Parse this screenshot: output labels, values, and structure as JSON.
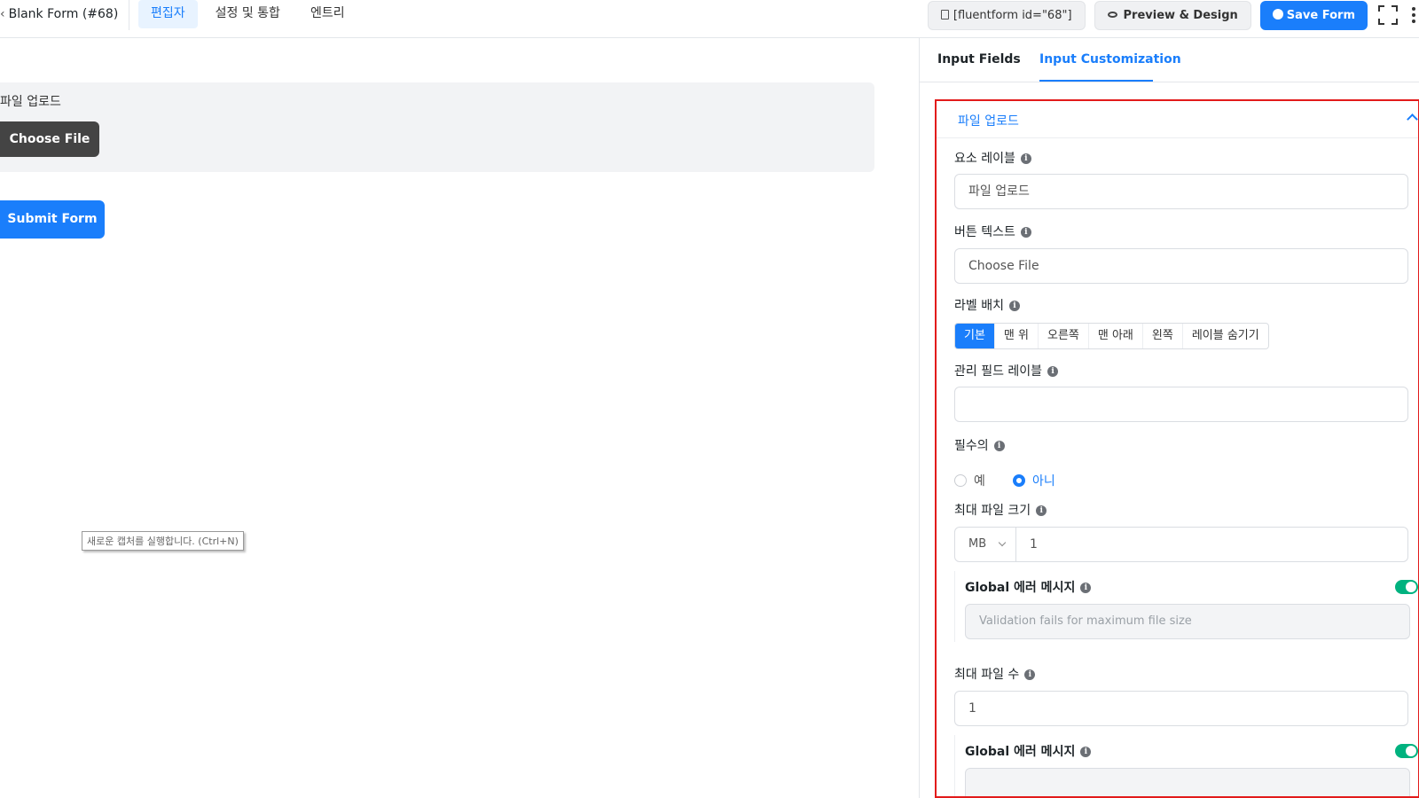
{
  "header": {
    "form_title": "Blank Form (#68)",
    "title_chevron": "‹",
    "nav_tabs": [
      {
        "label": "편집자",
        "active": true
      },
      {
        "label": "설정 및 통합",
        "active": false
      },
      {
        "label": "엔트리",
        "active": false
      }
    ],
    "shortcode_label": "[fluentform id=\"68\"]",
    "preview_label": "Preview & Design",
    "save_label": "Save Form"
  },
  "canvas": {
    "field_label": "파일 업로드",
    "choose_file_label": "Choose File",
    "submit_label": "Submit Form",
    "tooltip": "새로운 캡처를 실행합니다. (Ctrl+N)"
  },
  "panel": {
    "tabs": [
      "Input Fields",
      "Input Customization"
    ],
    "section_title": "파일 업로드",
    "element_label": {
      "label": "요소 레이블",
      "value": "파일 업로드"
    },
    "button_text": {
      "label": "버튼 텍스트",
      "value": "Choose File"
    },
    "label_placement": {
      "label": "라벨 배치",
      "options": [
        "기본",
        "맨 위",
        "오른쪽",
        "맨 아래",
        "왼쪽",
        "레이블 숨기기"
      ],
      "selected": "기본"
    },
    "admin_label": {
      "label": "관리 필드 레이블",
      "value": ""
    },
    "required": {
      "label": "필수의",
      "options": [
        "예",
        "아니"
      ],
      "selected": "아니"
    },
    "max_file_size": {
      "label": "최대 파일 크기",
      "unit": "MB",
      "value": "1",
      "global_error_label": "Global 에러 메시지",
      "global_error_enabled": true,
      "error_placeholder": "Validation fails for maximum file size"
    },
    "max_file_count": {
      "label": "최대 파일 수",
      "value": "1",
      "global_error_label": "Global 에러 메시지",
      "global_error_enabled": true
    },
    "info_glyph": "i"
  },
  "colors": {
    "accent": "#1a7efb",
    "highlight_border": "#e21b1b",
    "toggle_on": "#00b27f",
    "dark_button": "#444444"
  }
}
